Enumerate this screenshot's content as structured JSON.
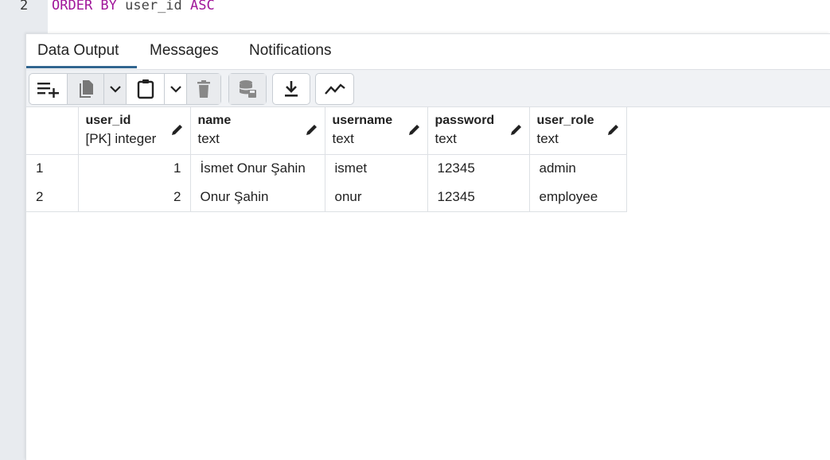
{
  "editor": {
    "line_number": "2",
    "code_kw1": "ORDER BY",
    "code_ident": " user_id ",
    "code_kw2": "ASC"
  },
  "tabs": [
    {
      "label": "Data Output",
      "active": true
    },
    {
      "label": "Messages"
    },
    {
      "label": "Notifications"
    }
  ],
  "toolbar": {
    "icons": [
      "add-row-icon",
      "copy-icon",
      "chevron-down-icon",
      "paste-icon",
      "chevron-down-icon",
      "delete-icon",
      "save-data-icon",
      "download-icon",
      "graph-icon"
    ]
  },
  "grid": {
    "columns": [
      {
        "name": "user_id",
        "type": "[PK] integer"
      },
      {
        "name": "name",
        "type": "text"
      },
      {
        "name": "username",
        "type": "text"
      },
      {
        "name": "password",
        "type": "text"
      },
      {
        "name": "user_role",
        "type": "text"
      }
    ],
    "rows": [
      {
        "num": "1",
        "cells": [
          "1",
          "İsmet Onur Şahin",
          "ismet",
          "12345",
          "admin"
        ]
      },
      {
        "num": "2",
        "cells": [
          "2",
          "Onur Şahin",
          "onur",
          "12345",
          "employee"
        ]
      }
    ]
  }
}
